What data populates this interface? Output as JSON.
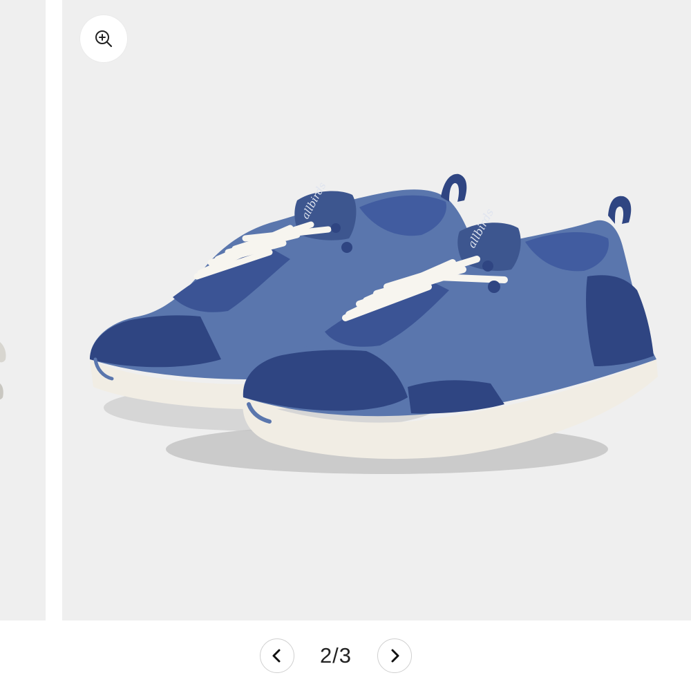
{
  "carousel": {
    "current_page": "2",
    "separator": "/",
    "total_pages": "3",
    "page_label": "2/3"
  },
  "buttons": {
    "zoom": "zoom-in-icon",
    "previous": "chevron-left-icon",
    "next": "chevron-right-icon"
  },
  "product_image": {
    "brand_mark": "allbirds",
    "colors": {
      "background": "#efefef",
      "upper": "#5a76ad",
      "overlay": "#2f4582",
      "sole": "#f1ede4",
      "laces": "#f7f5ef"
    }
  }
}
